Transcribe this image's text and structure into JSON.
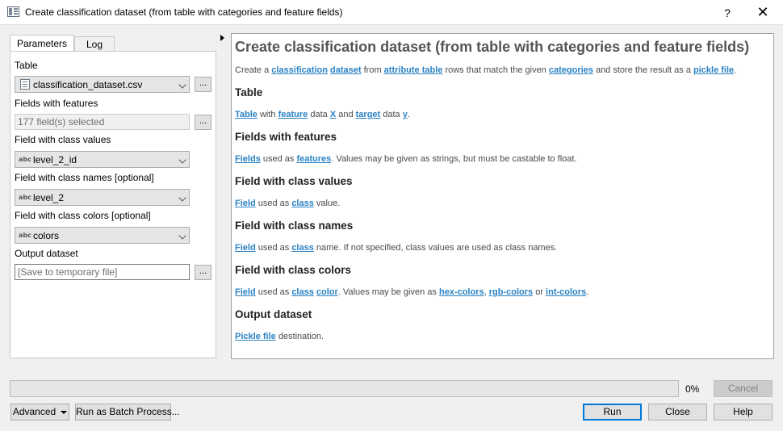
{
  "window": {
    "title": "Create classification dataset (from table with categories and feature fields)",
    "help_glyph": "?",
    "close_glyph": "✕"
  },
  "tabs": [
    {
      "label": "Parameters",
      "active": true
    },
    {
      "label": "Log",
      "active": false
    }
  ],
  "params": {
    "table": {
      "label": "Table",
      "value": "classification_dataset.csv",
      "icon": "table-icon"
    },
    "fields_with_features": {
      "label": "Fields with features",
      "value": "177 field(s) selected"
    },
    "class_values": {
      "label": "Field with class values",
      "value": "level_2_id",
      "type_badge": "abc"
    },
    "class_names": {
      "label": "Field with class names [optional]",
      "value": "level_2",
      "type_badge": "abc"
    },
    "class_colors": {
      "label": "Field with class colors [optional]",
      "value": "colors",
      "type_badge": "abc"
    },
    "output": {
      "label": "Output dataset",
      "placeholder": "[Save to temporary file]"
    },
    "dots_label": "..."
  },
  "help": {
    "title": "Create classification dataset (from table with categories and feature fields)",
    "intro": {
      "t1": "Create a ",
      "l1": "classification",
      "t2": " ",
      "l2": "dataset",
      "t3": " from ",
      "l3": "attribute table",
      "t4": " rows that match the given ",
      "l4": "categories",
      "t5": " and store the result as a ",
      "l5": "pickle file",
      "t6": "."
    },
    "table": {
      "heading": "Table",
      "l1": "Table",
      "t1": " with ",
      "l2": "feature",
      "t2": " data ",
      "l3": "X",
      "t3": " and ",
      "l4": "target",
      "t4": " data ",
      "l5": "y",
      "t5": "."
    },
    "features": {
      "heading": "Fields with features",
      "l1": "Fields",
      "t1": " used as ",
      "l2": "features",
      "t2": ". Values may be given as strings, but must be castable to float."
    },
    "class_values": {
      "heading": "Field with class values",
      "l1": "Field",
      "t1": " used as ",
      "l2": "class",
      "t2": " value."
    },
    "class_names": {
      "heading": "Field with class names",
      "l1": "Field",
      "t1": " used as ",
      "l2": "class",
      "t2": " name. If not specified, class values are used as class names."
    },
    "class_colors": {
      "heading": "Field with class colors",
      "l1": "Field",
      "t1": " used as ",
      "l2": "class",
      "t2": " ",
      "l3": "color",
      "t3": ". Values may be given as ",
      "l4": "hex-colors",
      "t4": ", ",
      "l5": "rgb-colors",
      "t5": " or ",
      "l6": "int-colors",
      "t6": "."
    },
    "output": {
      "heading": "Output dataset",
      "l1": "Pickle file",
      "t1": " destination."
    }
  },
  "footer": {
    "progress_percent": 0,
    "progress_text": "0%",
    "cancel": "Cancel",
    "advanced": "Advanced",
    "batch": "Run as Batch Process...",
    "run": "Run",
    "close": "Close",
    "help": "Help"
  },
  "colors": {
    "link": "#2a82c4",
    "default_button_border": "#0078d7"
  }
}
